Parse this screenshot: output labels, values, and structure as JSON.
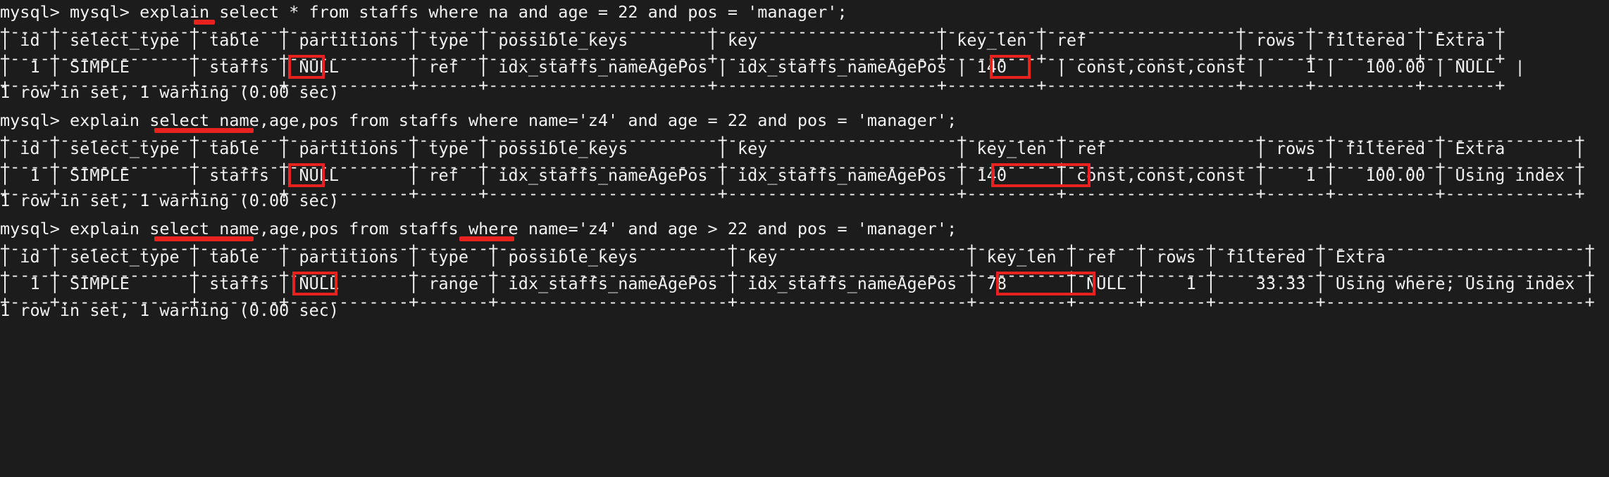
{
  "terminal": {
    "app": "mysql-client-terminal",
    "background_color": "#1c1c1c",
    "text_color": "#f2f2f2",
    "annotation_color": "#e8231f",
    "prompt": "mysql>"
  },
  "blocks": [
    {
      "id": "block-1",
      "prompt_line": "mysql> mysql> explain select * from staffs where na and age = 22 and pos = 'manager';",
      "border_top": "+----+-------------+--------+------------+------+----------------------+----------------------+---------+-------------------+------+----------+-------+",
      "header_line": "| id | select_type | table  | partitions | type | possible_keys        | key                  | key_len | ref               | rows | filtered | Extra |",
      "border_mid": "+----+-------------+--------+------------+------+----------------------+----------------------+---------+-------------------+------+----------+-------+",
      "data_line": "|  1 | SIMPLE      | staffs | NULL       | ref  | idx_staffs_nameAgePos | idx_staffs_nameAgePos | 140     | const,const,const |    1 |   100.00 | NULL  |",
      "border_bottom": "+----+-------------+--------+------------+------+----------------------+----------------------+---------+-------------------+------+----------+-------+",
      "status_line": "1 row in set, 1 warning (0.00 sec)",
      "columns": [
        "id",
        "select_type",
        "table",
        "partitions",
        "type",
        "possible_keys",
        "key",
        "key_len",
        "ref",
        "rows",
        "filtered",
        "Extra"
      ],
      "row": {
        "id": "1",
        "select_type": "SIMPLE",
        "table": "staffs",
        "partitions": "NULL",
        "type": "ref",
        "possible_keys": "idx_staffs_nameAgePos",
        "key": "idx_staffs_nameAgePos",
        "key_len": "140",
        "ref": "const,const,const",
        "rows": "1",
        "filtered": "100.00",
        "Extra": "NULL"
      },
      "annotations": [
        {
          "kind": "underline",
          "target": "select-star",
          "text": "*"
        },
        {
          "kind": "box",
          "target": "type-value",
          "text": "ref"
        },
        {
          "kind": "box",
          "target": "extra-value",
          "text": "NULL"
        }
      ]
    },
    {
      "id": "block-2",
      "prompt_line": "mysql> explain select name,age,pos from staffs where name='z4' and age = 22 and pos = 'manager';",
      "border_top": "+----+-------------+--------+------------+------+-----------------------+-----------------------+---------+-------------------+------+----------+-------------+",
      "header_line": "| id | select_type | table  | partitions | type | possible_keys         | key                   | key_len | ref               | rows | filtered | Extra       |",
      "border_mid": "+----+-------------+--------+------------+------+-----------------------+-----------------------+---------+-------------------+------+----------+-------------+",
      "data_line": "|  1 | SIMPLE      | staffs | NULL       | ref  | idx_staffs_nameAgePos | idx_staffs_nameAgePos | 140     | const,const,const |    1 |   100.00 | Using index |",
      "border_bottom": "+----+-------------+--------+------------+------+-----------------------+-----------------------+---------+-------------------+------+----------+-------------+",
      "status_line": "1 row in set, 1 warning (0.00 sec)",
      "columns": [
        "id",
        "select_type",
        "table",
        "partitions",
        "type",
        "possible_keys",
        "key",
        "key_len",
        "ref",
        "rows",
        "filtered",
        "Extra"
      ],
      "row": {
        "id": "1",
        "select_type": "SIMPLE",
        "table": "staffs",
        "partitions": "NULL",
        "type": "ref",
        "possible_keys": "idx_staffs_nameAgePos",
        "key": "idx_staffs_nameAgePos",
        "key_len": "140",
        "ref": "const,const,const",
        "rows": "1",
        "filtered": "100.00",
        "Extra": "Using index"
      },
      "annotations": [
        {
          "kind": "underline",
          "target": "select-columns",
          "text": "name,age,pos"
        },
        {
          "kind": "box",
          "target": "type-value",
          "text": "ref"
        },
        {
          "kind": "box",
          "target": "extra-value",
          "text": "Using index"
        }
      ]
    },
    {
      "id": "block-3",
      "prompt_line": "mysql> explain select name,age,pos from staffs where name='z4' and age > 22 and pos = 'manager';",
      "border_top": "+----+-------------+--------+------------+-------+-----------------------+-----------------------+---------+------+------+----------+--------------------------+",
      "header_line": "| id | select_type | table  | partitions | type  | possible_keys         | key                   | key_len | ref  | rows | filtered | Extra                    |",
      "border_mid": "+----+-------------+--------+------------+-------+-----------------------+-----------------------+---------+------+------+----------+--------------------------+",
      "data_line": "|  1 | SIMPLE      | staffs | NULL       | range | idx_staffs_nameAgePos | idx_staffs_nameAgePos | 78      | NULL |    1 |    33.33 | Using where; Using index |",
      "border_bottom": "+----+-------------+--------+------------+-------+-----------------------+-----------------------+---------+------+------+----------+--------------------------+",
      "status_line": "1 row in set, 1 warning (0.00 sec)",
      "columns": [
        "id",
        "select_type",
        "table",
        "partitions",
        "type",
        "possible_keys",
        "key",
        "key_len",
        "ref",
        "rows",
        "filtered",
        "Extra"
      ],
      "row": {
        "id": "1",
        "select_type": "SIMPLE",
        "table": "staffs",
        "partitions": "NULL",
        "type": "range",
        "possible_keys": "idx_staffs_nameAgePos",
        "key": "idx_staffs_nameAgePos",
        "key_len": "78",
        "ref": "NULL",
        "rows": "1",
        "filtered": "33.33",
        "Extra": "Using where; Using index"
      },
      "annotations": [
        {
          "kind": "underline",
          "target": "select-columns",
          "text": "name,age,pos"
        },
        {
          "kind": "underline",
          "target": "where-age-range",
          "text": "age"
        },
        {
          "kind": "box",
          "target": "type-value",
          "text": "range"
        },
        {
          "kind": "box",
          "target": "extra-value",
          "text": "Using index"
        }
      ]
    }
  ]
}
